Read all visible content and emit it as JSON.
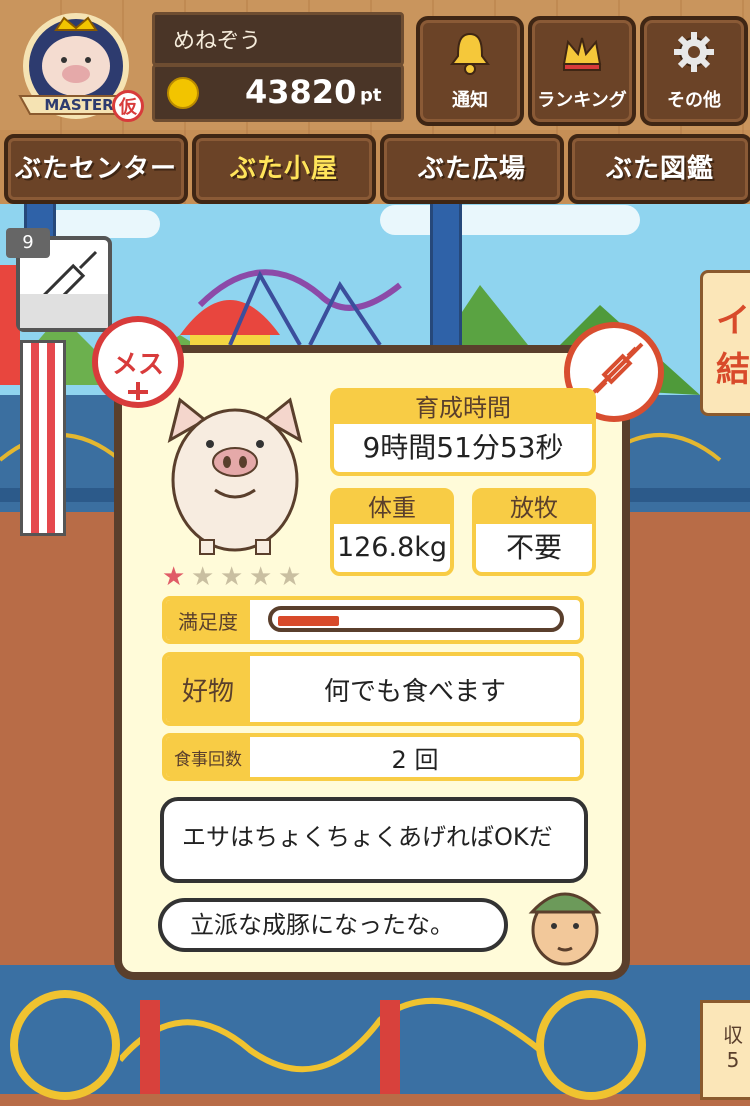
{
  "header": {
    "player_name": "めねぞう",
    "points": "43820",
    "points_unit": "pt",
    "badge_text": "MASTER",
    "badge_mark": "仮",
    "buttons": [
      {
        "label": "通知",
        "icon": "bell-icon"
      },
      {
        "label": "ランキング",
        "icon": "crown-icon"
      },
      {
        "label": "その他",
        "icon": "gear-icon"
      }
    ]
  },
  "nav": {
    "tabs": [
      {
        "label": "ぶたセンター",
        "active": false
      },
      {
        "label": "ぶた小屋",
        "active": true
      },
      {
        "label": "ぶた広場",
        "active": false
      },
      {
        "label": "ぶた図鑑",
        "active": false
      }
    ]
  },
  "syringe_badge": {
    "count": "9"
  },
  "side_sign": {
    "line1": "イ",
    "line2": "結"
  },
  "pig": {
    "sex_label": "メス",
    "rating": 1,
    "rating_max": 5,
    "training_time_label": "育成時間",
    "training_time_value": "9時間51分53秒",
    "weight_label": "体重",
    "weight_value": "126.8kg",
    "grazing_label": "放牧",
    "grazing_value": "不要",
    "satisfaction_label": "満足度",
    "satisfaction_level": 0.22,
    "favorite_label": "好物",
    "favorite_value": "何でも食べます",
    "meals_label": "食事回数",
    "meals_value": "2 回"
  },
  "dialogue": {
    "line1": "エサはちょくちょくあげればOKだ",
    "line2": "立派な成豚になったな。"
  },
  "corner_label": {
    "top": "収",
    "bottom": "5"
  },
  "colors": {
    "accent_yellow": "#f8cc45",
    "wood_dark": "#6b4327",
    "female_red": "#d83b3b",
    "satisfaction_fill": "#d84a2a"
  }
}
